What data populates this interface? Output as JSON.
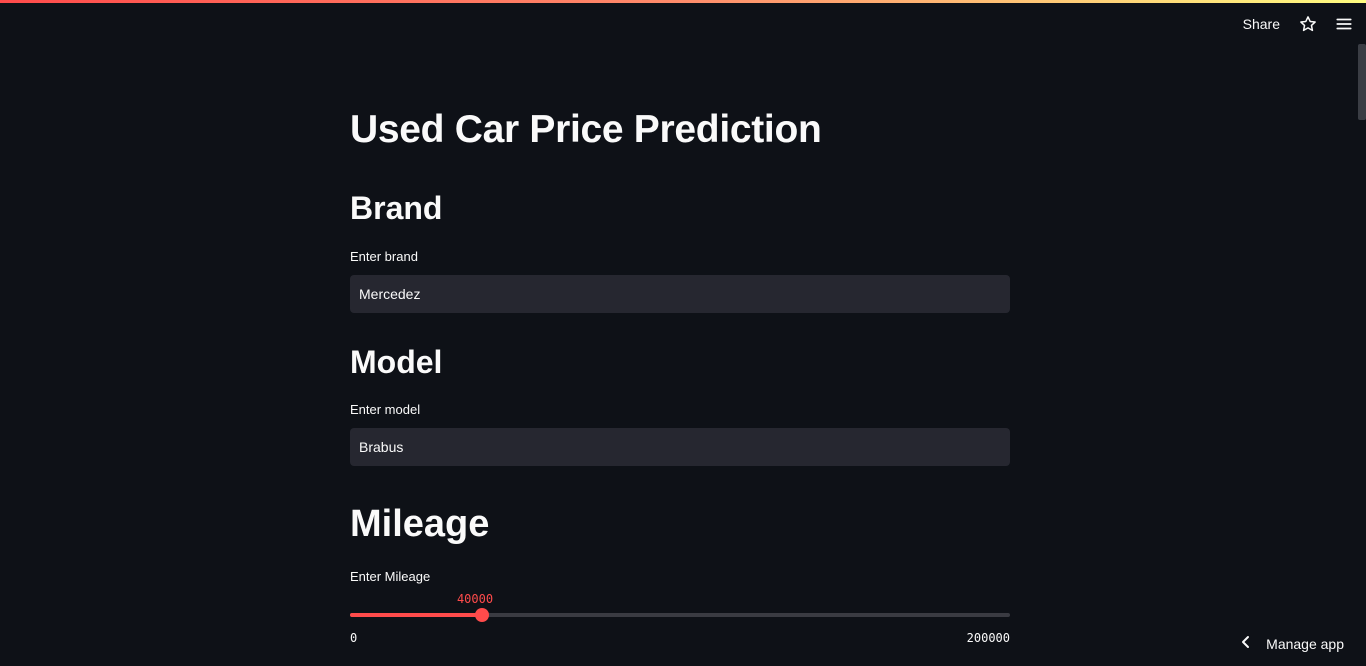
{
  "header": {
    "share_label": "Share",
    "star_icon": "star-outline-icon",
    "menu_icon": "hamburger-menu-icon"
  },
  "main": {
    "title": "Used Car Price Prediction",
    "brand": {
      "heading": "Brand",
      "label": "Enter brand",
      "value": "Mercedez"
    },
    "model": {
      "heading": "Model",
      "label": "Enter model",
      "value": "Brabus"
    },
    "mileage": {
      "heading": "Mileage",
      "label": "Enter Mileage",
      "value": 40000,
      "value_text": "40000",
      "min": 0,
      "min_text": "0",
      "max": 200000,
      "max_text": "200000"
    }
  },
  "footer": {
    "manage_label": "Manage app",
    "manage_icon": "chevron-left-icon"
  },
  "colors": {
    "background": "#0e1117",
    "accent": "#ff4b4b",
    "input_bg": "#262730",
    "text": "#fafafa"
  }
}
